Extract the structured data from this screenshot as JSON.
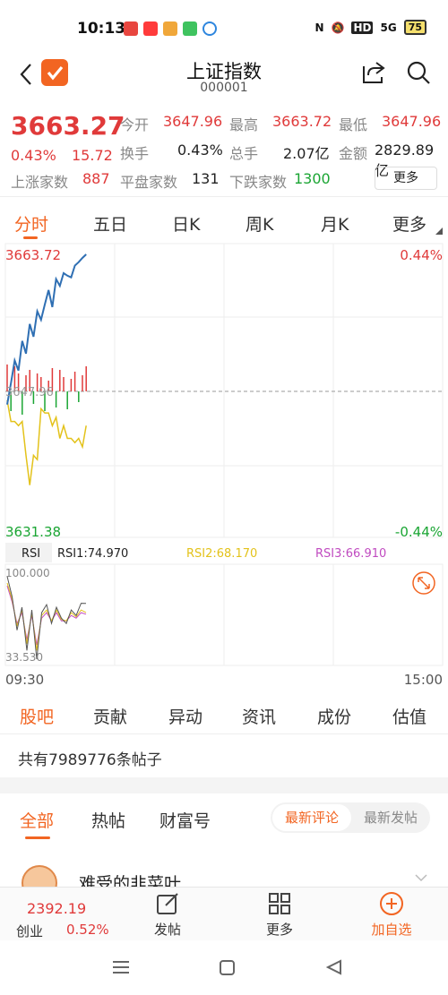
{
  "status_bar": {
    "time": "10:13",
    "battery": "75",
    "network": "5G"
  },
  "nav": {
    "title": "上证指数",
    "code": "000001"
  },
  "quote": {
    "price": "3663.27",
    "change_pct": "0.43%",
    "change": "15.72",
    "open_label": "今开",
    "open": "3647.96",
    "high_label": "最高",
    "high": "3663.72",
    "low_label": "最低",
    "low": "3647.96",
    "turnover_label": "换手",
    "turnover": "0.43%",
    "volume_label": "总手",
    "volume": "2.07亿",
    "amount_label": "金额",
    "amount": "2829.89亿",
    "up_label": "上涨家数",
    "up": "887",
    "flat_label": "平盘家数",
    "flat": "131",
    "down_label": "下跌家数",
    "down": "1300",
    "more_label": "更多"
  },
  "tabs": [
    "分时",
    "五日",
    "日K",
    "周K",
    "月K",
    "更多"
  ],
  "chart_labels": {
    "top_value": "3663.72",
    "top_pct": "0.44%",
    "mid_value": "3647.96",
    "bottom_value": "3631.38",
    "bottom_pct": "-0.44%",
    "rsi_label": "RSI",
    "rsi1": "RSI1:74.970",
    "rsi2": "RSI2:68.170",
    "rsi3": "RSI3:66.910",
    "rsi_top": "100.000",
    "rsi_bottom": "33.530",
    "time_start": "09:30",
    "time_end": "15:00"
  },
  "chart_data": {
    "type": "line",
    "price_ylim": [
      3631.38,
      3663.72
    ],
    "series": [
      {
        "values": [
          3646.0,
          3648.5,
          3651.2,
          3650.0,
          3653.5,
          3652.0,
          3655.5,
          3654.0,
          3657.0,
          3656.0,
          3657.8,
          3659.5,
          3657.5,
          3660.8,
          3660.0,
          3661.5,
          3661.2,
          3661.0,
          3662.4,
          3662.8,
          3663.3,
          3663.72
        ]
      },
      {
        "values": [
          3646.5,
          3644.0,
          3644.0,
          3643.5,
          3644.0,
          3640.0,
          3636.5,
          3640.0,
          3639.5,
          3645.5,
          3645.0,
          3645.0,
          3643.5,
          3644.5,
          3642.0,
          3643.5,
          3642.0,
          3642.0,
          3641.5,
          3642.0,
          3641.0,
          3643.5
        ]
      }
    ],
    "rsi_ylim": [
      33.53,
      100.0
    ],
    "rsi_series": [
      {
        "name": "RSI1",
        "values": [
          95,
          80,
          55,
          72,
          40,
          70,
          33.53,
          68,
          74,
          60,
          72,
          64,
          60,
          70,
          66,
          75,
          74.97
        ]
      },
      {
        "name": "RSI2",
        "values": [
          90,
          78,
          58,
          70,
          45,
          68,
          40,
          66,
          70,
          62,
          70,
          63,
          62,
          68,
          65,
          70,
          68.17
        ]
      },
      {
        "name": "RSI3",
        "values": [
          88,
          76,
          60,
          68,
          48,
          66,
          44,
          64,
          68,
          62,
          68,
          62,
          62,
          66,
          64,
          68,
          66.91
        ]
      }
    ],
    "ylim": [
      3631.38,
      3663.72
    ]
  },
  "sub_tabs": [
    "股吧",
    "贡献",
    "异动",
    "资讯",
    "成份",
    "估值"
  ],
  "posts_count_text": "共有7989776条帖子",
  "filter_tabs": [
    "全部",
    "热帖",
    "财富号"
  ],
  "toggle": {
    "on": "最新评论",
    "off": "最新发帖"
  },
  "post_preview": {
    "name": "难受的韭菜叶"
  },
  "bottom_bar": {
    "index_value": "2392.19",
    "index_name": "创业",
    "index_pct": "0.52%",
    "post_label": "发帖",
    "more_label": "更多",
    "add_label": "加自选"
  },
  "colors": {
    "accent": "#f26522",
    "up": "#e03a3a",
    "down": "#1aa533",
    "price_line": "#2f6fb3",
    "avg_line": "#e3c21a",
    "rsi3": "#c04ac0"
  }
}
